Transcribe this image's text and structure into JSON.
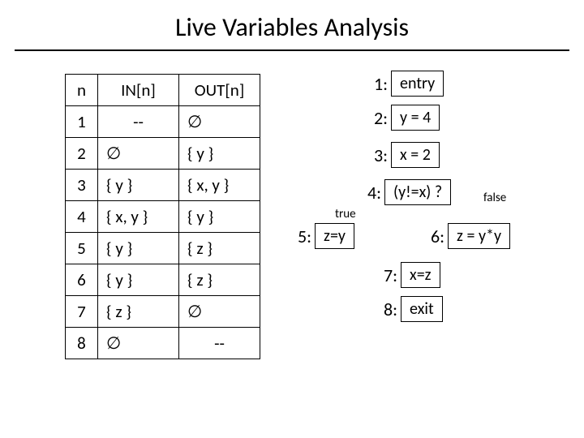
{
  "title": "Live Variables Analysis",
  "table": {
    "headers": {
      "n": "n",
      "in": "IN[n]",
      "out": "OUT[n]"
    },
    "rows": [
      {
        "n": "1",
        "in": "--",
        "out": "∅"
      },
      {
        "n": "2",
        "in": "∅",
        "out": "{ y }"
      },
      {
        "n": "3",
        "in": "{ y }",
        "out": "{ x, y }"
      },
      {
        "n": "4",
        "in": "{ x, y }",
        "out": "{ y }"
      },
      {
        "n": "5",
        "in": "{ y }",
        "out": "{ z }"
      },
      {
        "n": "6",
        "in": "{ y }",
        "out": "{ z }"
      },
      {
        "n": "7",
        "in": "{ z }",
        "out": "∅"
      },
      {
        "n": "8",
        "in": "∅",
        "out": "   --"
      }
    ]
  },
  "cfg": {
    "nodes": {
      "n1": {
        "num": "1:",
        "label": "entry"
      },
      "n2": {
        "num": "2:",
        "label": "y = 4"
      },
      "n3": {
        "num": "3:",
        "label": "x = 2"
      },
      "n4": {
        "num": "4:",
        "label": "(y!=x) ?"
      },
      "n5": {
        "num": "5:",
        "label": "z=y"
      },
      "n6": {
        "num": "6:",
        "label": "z = y*y"
      },
      "n7": {
        "num": "7:",
        "label": "x=z"
      },
      "n8": {
        "num": "8:",
        "label": "exit"
      }
    },
    "edges": {
      "true": "true",
      "false": "false"
    }
  }
}
